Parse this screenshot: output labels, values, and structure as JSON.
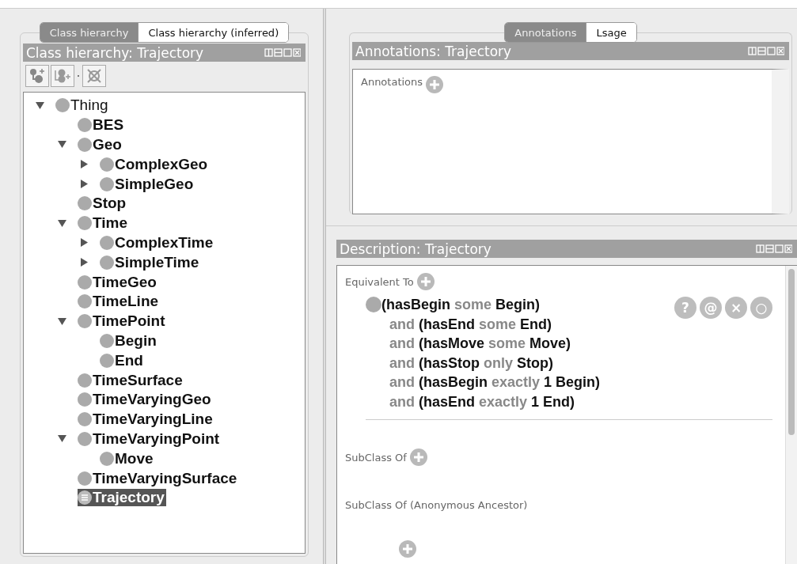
{
  "left_tabs": [
    {
      "label": "Class hierarchy",
      "selected": true
    },
    {
      "label": "Class hierarchy (inferred)",
      "selected": false
    }
  ],
  "class_hierarchy": {
    "title": "Class hierarchy: Trajectory",
    "tree": [
      {
        "label": "Thing",
        "expanded": true,
        "selected": false,
        "children": [
          {
            "label": "BES",
            "selected": false
          },
          {
            "label": "Geo",
            "expanded": true,
            "selected": false,
            "children": [
              {
                "label": "ComplexGeo",
                "expanded": false,
                "selected": false
              },
              {
                "label": "SimpleGeo",
                "expanded": false,
                "selected": false
              }
            ]
          },
          {
            "label": "Stop",
            "selected": false
          },
          {
            "label": "Time",
            "expanded": true,
            "selected": false,
            "children": [
              {
                "label": "ComplexTime",
                "expanded": false,
                "selected": false
              },
              {
                "label": "SimpleTime",
                "expanded": false,
                "selected": false
              }
            ]
          },
          {
            "label": "TimeGeo",
            "selected": false
          },
          {
            "label": "TimeLine",
            "selected": false
          },
          {
            "label": "TimePoint",
            "expanded": true,
            "selected": false,
            "children": [
              {
                "label": "Begin",
                "selected": false
              },
              {
                "label": "End",
                "selected": false
              }
            ]
          },
          {
            "label": "TimeSurface",
            "selected": false
          },
          {
            "label": "TimeVaryingGeo",
            "selected": false
          },
          {
            "label": "TimeVaryingLine",
            "selected": false
          },
          {
            "label": "TimeVaryingPoint",
            "expanded": true,
            "selected": false,
            "children": [
              {
                "label": "Move",
                "selected": false
              }
            ]
          },
          {
            "label": "TimeVaryingSurface",
            "selected": false
          },
          {
            "label": "Trajectory",
            "selected": true,
            "kind": "defined"
          }
        ]
      }
    ]
  },
  "right_tabs": [
    {
      "label": "Annotations",
      "selected": true
    },
    {
      "label": "Lsage",
      "selected": false
    }
  ],
  "annotations": {
    "title": "Annotations: Trajectory",
    "section": "Annotations"
  },
  "description": {
    "title": "Description: Trajectory",
    "equivalent_to": {
      "label": "Equivalent To",
      "lines": [
        "**(hasBegin** some **Begin)**",
        "and **(hasEnd** some **End)**",
        "and **(hasMove** some **Move)**",
        "and **(hasStop** only **Stop)**",
        "and **(hasBegin** exactly **1 Begin)**",
        "and **(hasEnd** exactly **1 End)**"
      ],
      "actions": [
        "?",
        "@",
        "×",
        "○"
      ]
    },
    "sections": [
      {
        "label": "SubClass Of",
        "addable": true
      },
      {
        "label": "SubClass Of (Anonymous Ancestor)",
        "addable": false
      }
    ]
  }
}
